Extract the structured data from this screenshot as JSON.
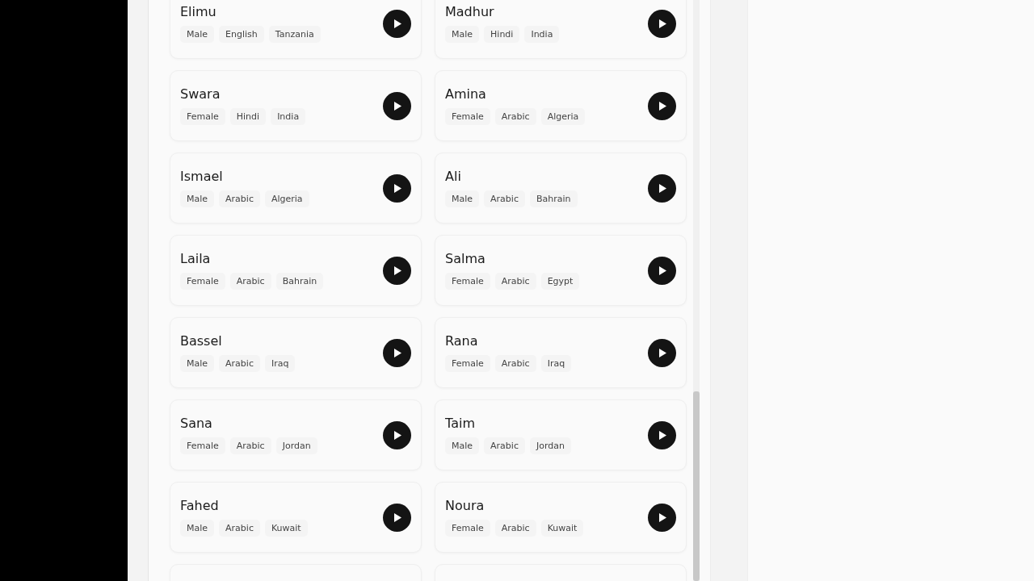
{
  "voices": [
    {
      "kind": "voice",
      "name": "Elimu",
      "tags": [
        "Male",
        "English",
        "Tanzania"
      ]
    },
    {
      "kind": "voice",
      "name": "Madhur",
      "tags": [
        "Male",
        "Hindi",
        "India"
      ]
    },
    {
      "kind": "voice",
      "name": "Swara",
      "tags": [
        "Female",
        "Hindi",
        "India"
      ]
    },
    {
      "kind": "voice",
      "name": "Amina",
      "tags": [
        "Female",
        "Arabic",
        "Algeria"
      ]
    },
    {
      "kind": "voice",
      "name": "Ismael",
      "tags": [
        "Male",
        "Arabic",
        "Algeria"
      ]
    },
    {
      "kind": "voice",
      "name": "Ali",
      "tags": [
        "Male",
        "Arabic",
        "Bahrain"
      ]
    },
    {
      "kind": "voice",
      "name": "Laila",
      "tags": [
        "Female",
        "Arabic",
        "Bahrain"
      ]
    },
    {
      "kind": "voice",
      "name": "Salma",
      "tags": [
        "Female",
        "Arabic",
        "Egypt"
      ]
    },
    {
      "kind": "voice",
      "name": "Bassel",
      "tags": [
        "Male",
        "Arabic",
        "Iraq"
      ]
    },
    {
      "kind": "voice",
      "name": "Rana",
      "tags": [
        "Female",
        "Arabic",
        "Iraq"
      ]
    },
    {
      "kind": "voice",
      "name": "Sana",
      "tags": [
        "Female",
        "Arabic",
        "Jordan"
      ]
    },
    {
      "kind": "voice",
      "name": "Taim",
      "tags": [
        "Male",
        "Arabic",
        "Jordan"
      ]
    },
    {
      "kind": "voice",
      "name": "Fahed",
      "tags": [
        "Male",
        "Arabic",
        "Kuwait"
      ]
    },
    {
      "kind": "voice",
      "name": "Noura",
      "tags": [
        "Female",
        "Arabic",
        "Kuwait"
      ]
    },
    {
      "kind": "cut"
    },
    {
      "kind": "cut"
    }
  ]
}
